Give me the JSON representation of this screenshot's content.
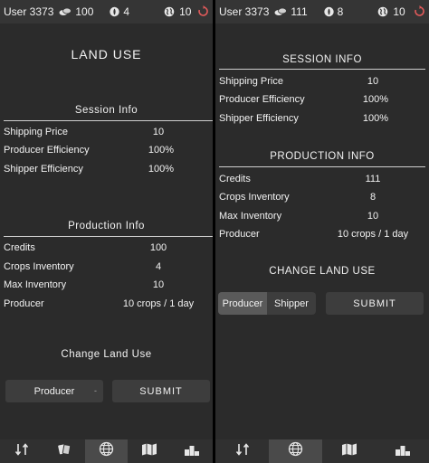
{
  "left": {
    "user": "User 3373",
    "credits": "100",
    "inventory": "4",
    "players": "10",
    "title": "LAND USE",
    "session_heading": "Session Info",
    "session": [
      {
        "label": "Shipping Price",
        "value": "10"
      },
      {
        "label": "Producer Efficiency",
        "value": "100%"
      },
      {
        "label": "Shipper Efficiency",
        "value": "100%"
      }
    ],
    "production_heading": "Production Info",
    "production": [
      {
        "label": "Credits",
        "value": "100"
      },
      {
        "label": "Crops Inventory",
        "value": "4"
      },
      {
        "label": "Max Inventory",
        "value": "10"
      },
      {
        "label": "Producer",
        "value": "10 crops / 1 day"
      }
    ],
    "change_heading": "Change Land Use",
    "select_value": "Producer",
    "select_caret": "-",
    "submit_label": "SUBMIT"
  },
  "right": {
    "user": "User 3373",
    "credits": "111",
    "inventory": "8",
    "players": "10",
    "session_heading": "SESSION INFO",
    "session": [
      {
        "label": "Shipping Price",
        "value": "10"
      },
      {
        "label": "Producer Efficiency",
        "value": "100%"
      },
      {
        "label": "Shipper Efficiency",
        "value": "100%"
      }
    ],
    "production_heading": "PRODUCTION INFO",
    "production": [
      {
        "label": "Credits",
        "value": "111"
      },
      {
        "label": "Crops Inventory",
        "value": "8"
      },
      {
        "label": "Max Inventory",
        "value": "10"
      },
      {
        "label": "Producer",
        "value": "10 crops / 1 day"
      }
    ],
    "change_heading": "CHANGE LAND USE",
    "options": [
      "Producer",
      "Shipper"
    ],
    "selected_option": "Producer",
    "submit_label": "SUBMIT"
  },
  "icons": {
    "credits": "coins-icon",
    "inventory": "seed-icon",
    "players": "globe-icon",
    "refresh": "refresh-icon",
    "nav": [
      "sort-icon",
      "cards-icon",
      "globe-icon",
      "map-icon",
      "podium-icon"
    ]
  },
  "colors": {
    "background": "#2b2b2b",
    "bar": "#353535",
    "button": "#3d3d3d",
    "refresh": "#e05a5a"
  }
}
